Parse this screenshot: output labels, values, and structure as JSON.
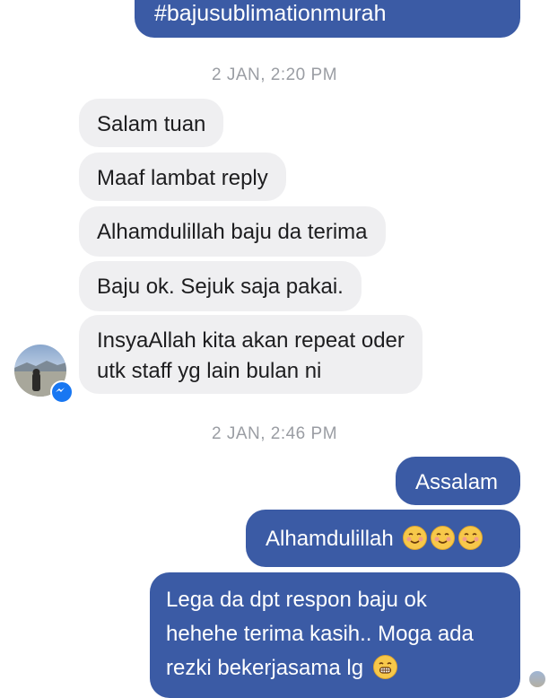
{
  "messages": {
    "top_hashtag": "#bajusublimationmurah",
    "timestamp_1": "2 JAN, 2:20 PM",
    "incoming": [
      "Salam tuan",
      "Maaf lambat reply",
      "Alhamdulillah baju da terima",
      "Baju ok. Sejuk saja pakai.",
      "InsyaAllah kita akan repeat oder",
      "utk staff yg lain bulan ni"
    ],
    "timestamp_2": "2 JAN, 2:46 PM",
    "outgoing": {
      "assalam": "Assalam",
      "alhamdulillah": "Alhamdulillah",
      "lega_line1": "Lega da dpt respon baju ok",
      "lega_line2": "hehehe terima kasih.. Moga ada",
      "lega_line3": "rezki bekerjasama lg"
    }
  },
  "icons": {
    "avatar": "profile-photo",
    "badge": "messenger-icon",
    "emoji_smile": "smiling-face-emoji",
    "emoji_grin": "grinning-face-emoji"
  },
  "colors": {
    "outgoing_bubble": "#3b5ba5",
    "incoming_bubble": "#efeff1",
    "timestamp": "#9a9da3",
    "messenger_blue": "#1877f2"
  }
}
